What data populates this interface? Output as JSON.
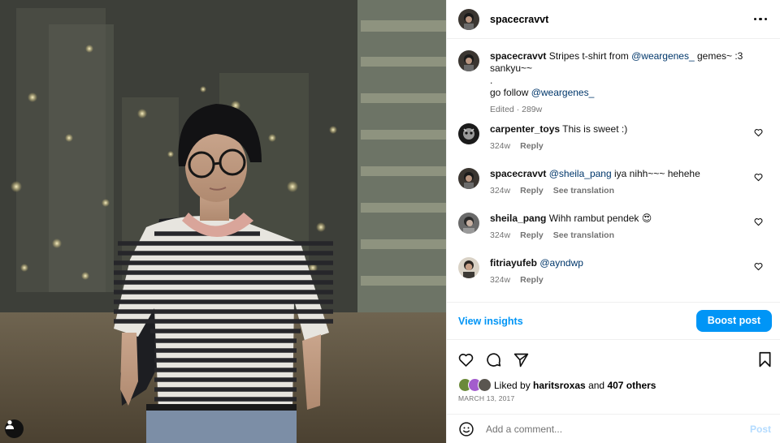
{
  "post": {
    "username": "spacecravvt",
    "more_label": "More options"
  },
  "caption": {
    "username": "spacecravvt",
    "text_part1": "Stripes t-shirt from ",
    "mention1": "@weargenes_",
    "text_part2": " gemes~ :3 sankyu~~",
    "line2": ".",
    "line3_text": "go follow ",
    "mention2": "@weargenes_",
    "meta": "Edited · 289w"
  },
  "comments": [
    {
      "username": "carpenter_toys",
      "mention": "",
      "text": "This is sweet :)",
      "time": "324w",
      "reply": "Reply",
      "translate": ""
    },
    {
      "username": "spacecravvt",
      "mention": "@sheila_pang",
      "text": " iya nihh~~~ hehehe",
      "time": "324w",
      "reply": "Reply",
      "translate": "See translation"
    },
    {
      "username": "sheila_pang",
      "mention": "",
      "text": "Wihh rambut pendek 😍",
      "time": "324w",
      "reply": "Reply",
      "translate": "See translation"
    },
    {
      "username": "fitriayufeb",
      "mention": "@ayndwp",
      "text": "",
      "time": "324w",
      "reply": "Reply",
      "translate": ""
    }
  ],
  "actions": {
    "insights": "View insights",
    "boost": "Boost post"
  },
  "likes": {
    "prefix": "Liked by ",
    "user": "haritsroxas",
    "middle": " and ",
    "others": "407 others"
  },
  "date": "MARCH 13, 2017",
  "add_comment": {
    "placeholder": "Add a comment...",
    "post": "Post"
  },
  "icons": [
    "heart-icon",
    "comment-icon",
    "share-icon",
    "bookmark-icon",
    "emoji-icon",
    "user-tag-icon",
    "more-icon"
  ],
  "colors": {
    "accent": "#0095f6",
    "mention": "#00376b",
    "muted": "#737373",
    "post_disabled": "#b3dbff"
  }
}
